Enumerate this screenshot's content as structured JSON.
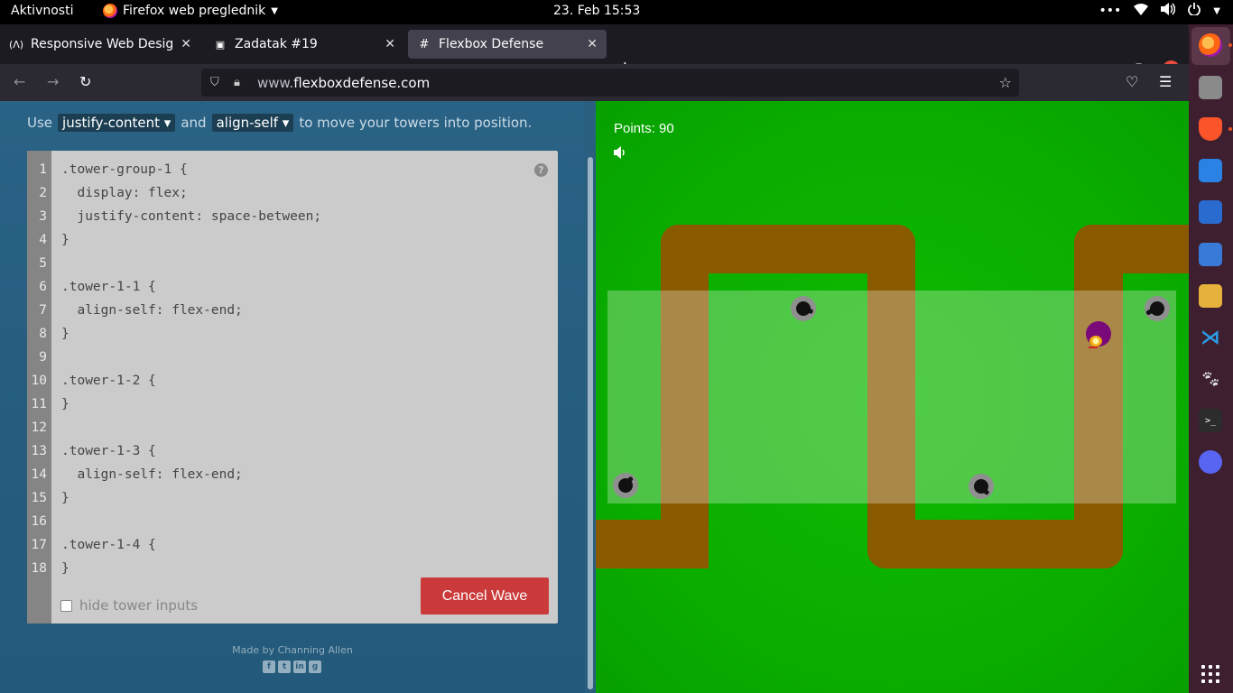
{
  "topbar": {
    "activities": "Aktivnosti",
    "app_name": "Firefox web preglednik",
    "clock": "23. Feb  15:53"
  },
  "tabs": [
    {
      "title": "Responsive Web Design C",
      "icon": "freecodecamp-icon"
    },
    {
      "title": "Zadatak #19",
      "icon": "classroom-icon"
    },
    {
      "title": "Flexbox Defense",
      "icon": "hash-icon"
    }
  ],
  "navbar": {
    "url_prefix": "www.",
    "url_domain": "flexboxdefense.com"
  },
  "instructions": {
    "use": "Use",
    "prop1": "justify-content ▾",
    "and": "and",
    "prop2": "align-self ▾",
    "rest": "to move your towers into position."
  },
  "code_lines": [
    {
      "n": "1",
      "text": ".tower-group-1 {"
    },
    {
      "n": "2",
      "text": "  display: flex;"
    },
    {
      "n": "3",
      "text": "  justify-content: space-between;"
    },
    {
      "n": "4",
      "text": "}"
    },
    {
      "n": "5",
      "text": ""
    },
    {
      "n": "6",
      "text": ".tower-1-1 {"
    },
    {
      "n": "7",
      "text": "  align-self: flex-end;"
    },
    {
      "n": "8",
      "text": "}"
    },
    {
      "n": "9",
      "text": ""
    },
    {
      "n": "10",
      "text": ".tower-1-2 {"
    },
    {
      "n": "11",
      "text": "}"
    },
    {
      "n": "12",
      "text": ""
    },
    {
      "n": "13",
      "text": ".tower-1-3 {"
    },
    {
      "n": "14",
      "text": "  align-self: flex-end;"
    },
    {
      "n": "15",
      "text": "}"
    },
    {
      "n": "16",
      "text": ""
    },
    {
      "n": "17",
      "text": ".tower-1-4 {"
    },
    {
      "n": "18",
      "text": "}"
    }
  ],
  "editor": {
    "help": "?",
    "cancel_label": "Cancel Wave",
    "hide_label": "hide tower inputs"
  },
  "footer": {
    "credit": "Made by Channing Allen"
  },
  "game": {
    "points": "Points: 90"
  },
  "colors": {
    "board": "#0aad00",
    "path": "#8a5a00",
    "cancel": "#cb3a3a",
    "enemy": "#7a0a7a"
  }
}
